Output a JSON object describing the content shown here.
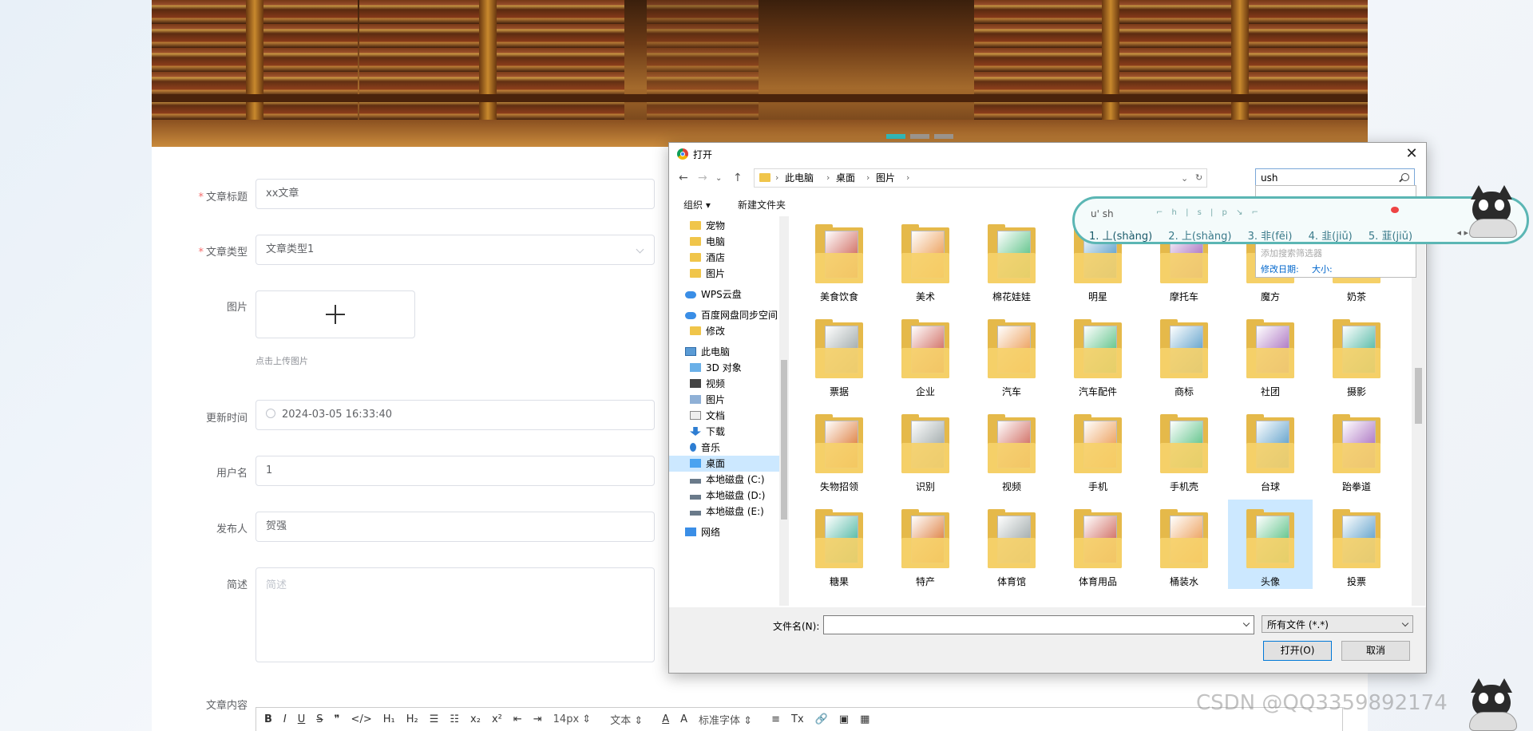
{
  "form": {
    "fields": [
      {
        "label": "文章标题",
        "required": true,
        "value": "xx文章"
      },
      {
        "label": "文章类型",
        "required": true,
        "value": "文章类型1"
      },
      {
        "label": "图片",
        "upload_hint": "点击上传图片"
      },
      {
        "label": "更新时间",
        "value": "2024-03-05 16:33:40"
      },
      {
        "label": "用户名",
        "value": "1"
      },
      {
        "label": "发布人",
        "value": "贺强"
      },
      {
        "label": "简述",
        "placeholder": "简述"
      },
      {
        "label": "文章内容"
      }
    ],
    "editor_toolbar": [
      "B",
      "I",
      "U",
      "S",
      "❞",
      "</>",
      "H₁",
      "H₂",
      "☰",
      "☷",
      "x₂",
      "x²",
      "⇤",
      "⇥",
      "14px",
      "文本",
      "A",
      "A",
      "标准字体",
      "≡",
      "Tx",
      "🔗",
      "▣",
      "▦"
    ],
    "editor_selects": {
      "size": "14px",
      "type": "文本",
      "font": "标准字体"
    }
  },
  "dialog": {
    "title": "打开",
    "breadcrumb": [
      "此电脑",
      "桌面",
      "图片"
    ],
    "search_value": "ush",
    "commands": {
      "organize": "组织 ▾",
      "new_folder": "新建文件夹"
    },
    "sidebar": [
      {
        "label": "宠物",
        "icon": "folder"
      },
      {
        "label": "电脑",
        "icon": "folder"
      },
      {
        "label": "酒店",
        "icon": "folder"
      },
      {
        "label": "图片",
        "icon": "folder"
      },
      {
        "label": "WPS云盘",
        "icon": "cloud"
      },
      {
        "label": "百度网盘同步空间",
        "icon": "cloud"
      },
      {
        "label": "修改",
        "icon": "folder"
      },
      {
        "label": "此电脑",
        "icon": "pc"
      },
      {
        "label": "3D 对象",
        "icon": "3d"
      },
      {
        "label": "视频",
        "icon": "video"
      },
      {
        "label": "图片",
        "icon": "picture"
      },
      {
        "label": "文档",
        "icon": "document"
      },
      {
        "label": "下载",
        "icon": "download"
      },
      {
        "label": "音乐",
        "icon": "music"
      },
      {
        "label": "桌面",
        "icon": "desktop",
        "selected": true
      },
      {
        "label": "本地磁盘 (C:)",
        "icon": "disk"
      },
      {
        "label": "本地磁盘 (D:)",
        "icon": "disk"
      },
      {
        "label": "本地磁盘 (E:)",
        "icon": "disk"
      },
      {
        "label": "网络",
        "icon": "network"
      }
    ],
    "folders": [
      [
        "美食饮食",
        "美术",
        "棉花娃娃",
        "明星",
        "摩托车",
        "魔方",
        "奶茶"
      ],
      [
        "票据",
        "企业",
        "汽车",
        "汽车配件",
        "商标",
        "社团",
        "摄影"
      ],
      [
        "失物招领",
        "识别",
        "视频",
        "手机",
        "手机壳",
        "台球",
        "跆拳道"
      ],
      [
        "糖果",
        "特产",
        "体育馆",
        "体育用品",
        "桶装水",
        "头像",
        "投票"
      ]
    ],
    "selected_folder": "头像",
    "filename_label": "文件名(N):",
    "filename_value": "",
    "filetype": "所有文件 (*.*)",
    "open_button": "打开(O)",
    "cancel_button": "取消"
  },
  "search_dropdown": {
    "dim_text": "添加搜索筛选器",
    "modified": "修改日期:",
    "size": "大小:"
  },
  "ime": {
    "composition": "u' sh",
    "candidates": [
      "1. 丄(shàng)",
      "2. 上(shàng)",
      "3. 非(fēi)",
      "4. 韭(jiǔ)",
      "5. 韮(jiǔ)"
    ]
  },
  "watermark": "CSDN @QQ3359892174",
  "colors": {
    "accent": "#5bb6b4",
    "required": "#f56c6c",
    "selection": "#cce8ff"
  }
}
